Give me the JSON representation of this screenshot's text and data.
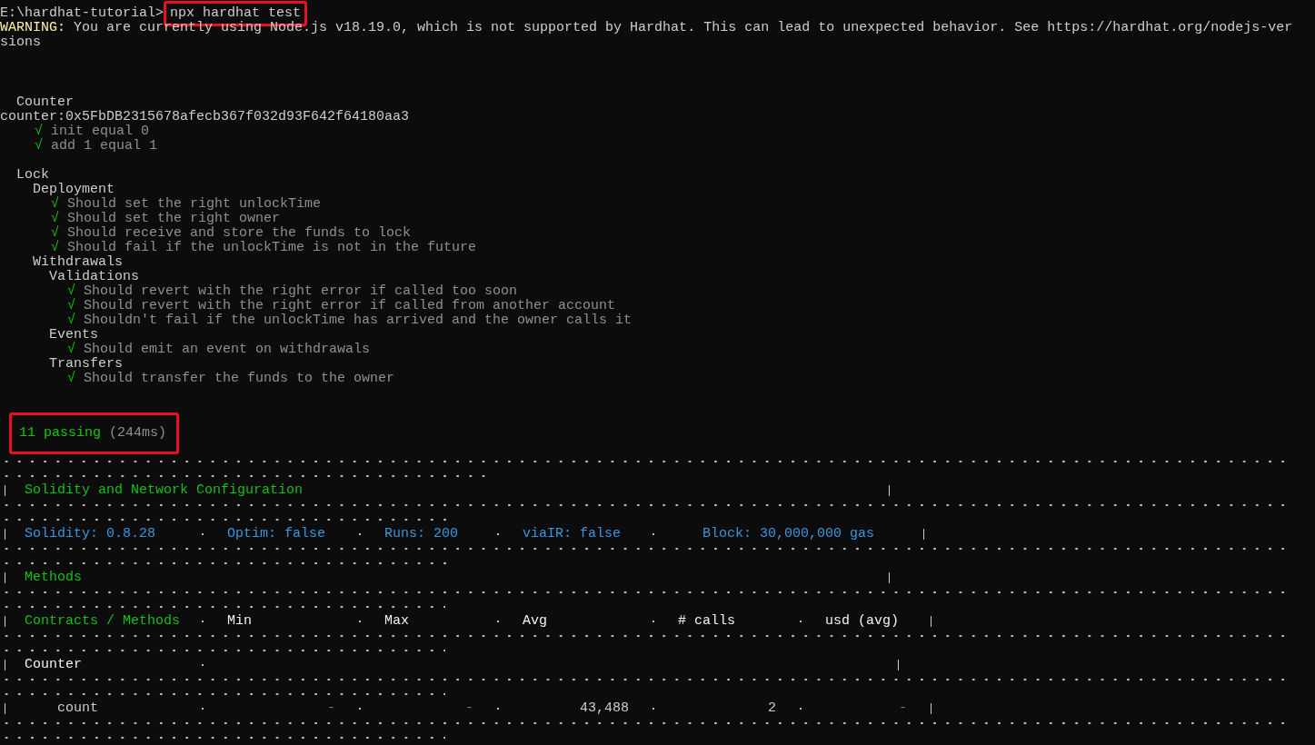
{
  "prompt": {
    "path": "E:\\hardhat-tutorial>",
    "command": "npx hardhat test",
    "highlighted": true
  },
  "warning": {
    "label": "WARNING:",
    "lines": [
      "You are currently using Node.js v18.19.0, which is not supported by Hardhat. This can lead to unexpected behavior. See https://hardhat.org/nodejs-ver",
      "sions"
    ]
  },
  "suites": [
    {
      "kind": "suite",
      "title": "Counter",
      "children": [
        {
          "kind": "log",
          "text": "counter:0x5FbDB2315678afecb367f032d93F642f64180aa3"
        },
        {
          "kind": "test",
          "mark": "√",
          "title": "init equal 0"
        },
        {
          "kind": "test",
          "mark": "√",
          "title": "add 1 equal 1"
        }
      ]
    },
    {
      "kind": "suite",
      "title": "Lock",
      "children": [
        {
          "kind": "suite",
          "title": "Deployment",
          "children": [
            {
              "kind": "test",
              "mark": "√",
              "title": "Should set the right unlockTime"
            },
            {
              "kind": "test",
              "mark": "√",
              "title": "Should set the right owner"
            },
            {
              "kind": "test",
              "mark": "√",
              "title": "Should receive and store the funds to lock"
            },
            {
              "kind": "test",
              "mark": "√",
              "title": "Should fail if the unlockTime is not in the future"
            }
          ]
        },
        {
          "kind": "suite",
          "title": "Withdrawals",
          "children": [
            {
              "kind": "suite",
              "title": "Validations",
              "children": [
                {
                  "kind": "test",
                  "mark": "√",
                  "title": "Should revert with the right error if called too soon"
                },
                {
                  "kind": "test",
                  "mark": "√",
                  "title": "Should revert with the right error if called from another account"
                },
                {
                  "kind": "test",
                  "mark": "√",
                  "title": "Shouldn't fail if the unlockTime has arrived and the owner calls it"
                }
              ]
            },
            {
              "kind": "suite",
              "title": "Events",
              "children": [
                {
                  "kind": "test",
                  "mark": "√",
                  "title": "Should emit an event on withdrawals"
                }
              ]
            },
            {
              "kind": "suite",
              "title": "Transfers",
              "children": [
                {
                  "kind": "test",
                  "mark": "√",
                  "title": "Should transfer the funds to the owner"
                }
              ]
            }
          ]
        }
      ]
    }
  ],
  "summary": {
    "passing": "11 passing",
    "duration": "(244ms)",
    "highlighted": true
  },
  "gas_report": {
    "title": "Solidity and Network Configuration",
    "config": [
      "Solidity: 0.8.28",
      "Optim: false",
      "Runs: 200",
      "viaIR: false",
      "Block: 30,000,000 gas"
    ],
    "methods_title": "Methods",
    "columns": [
      "Contracts / Methods",
      "Min",
      "Max",
      "Avg",
      "# calls",
      "usd (avg)"
    ],
    "rows": [
      {
        "kind": "contract",
        "cells": [
          "Counter"
        ]
      },
      {
        "kind": "method",
        "cells": [
          "count",
          "-",
          "-",
          "43,488",
          "2",
          "-"
        ]
      }
    ]
  }
}
